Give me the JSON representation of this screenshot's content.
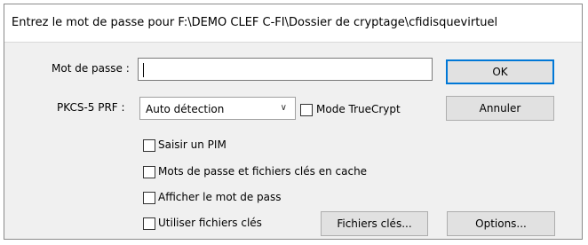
{
  "dialog": {
    "title": "Entrez le mot de passe pour F:\\DEMO CLEF C-FI\\Dossier de cryptage\\cfidisquevirtuel"
  },
  "password": {
    "label": "Mot de passe :",
    "value": ""
  },
  "prf": {
    "label": "PKCS-5 PRF :",
    "selected": "Auto détection"
  },
  "buttons": {
    "ok": "OK",
    "cancel": "Annuler",
    "keyfiles": "Fichiers clés...",
    "options": "Options..."
  },
  "checkboxes": {
    "truecrypt": {
      "label": "Mode TrueCrypt",
      "checked": false
    },
    "pim": {
      "label": "Saisir un PIM",
      "checked": false
    },
    "cache": {
      "label": "Mots de passe et fichiers clés en cache",
      "checked": false
    },
    "show": {
      "label": "Afficher le mot de pass",
      "checked": false
    },
    "keyfiles": {
      "label": "Utiliser fichiers clés",
      "checked": false
    }
  },
  "icons": {
    "dropdown": "chevron-down-icon"
  }
}
